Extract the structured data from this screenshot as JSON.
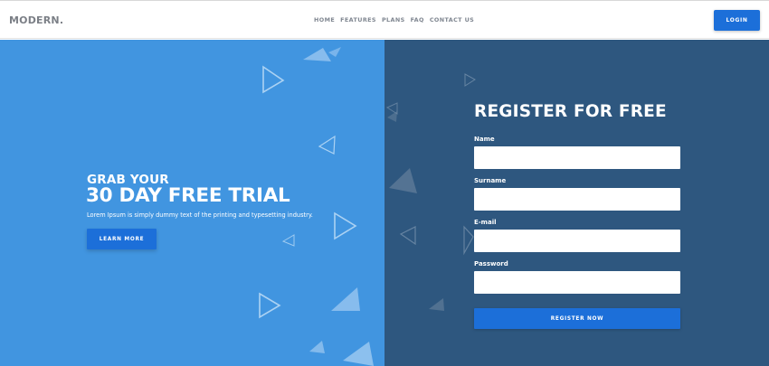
{
  "header": {
    "logo": "MODERN.",
    "nav": [
      "HOME",
      "FEATURES",
      "PLANS",
      "FAQ",
      "CONTACT US"
    ],
    "login_label": "LOGIN"
  },
  "hero": {
    "subtitle": "GRAB YOUR",
    "title": "30 DAY FREE TRIAL",
    "description": "Lorem Ipsum is simply dummy text of the printing and typesetting industry.",
    "button_label": "LEARN MORE"
  },
  "form": {
    "title": "REGISTER FOR FREE",
    "fields": [
      {
        "label": "Name",
        "value": ""
      },
      {
        "label": "Surname",
        "value": ""
      },
      {
        "label": "E-mail",
        "value": ""
      },
      {
        "label": "Password",
        "value": ""
      }
    ],
    "submit_label": "REGISTER NOW"
  },
  "colors": {
    "left_panel": "#4195e0",
    "right_panel": "#2e577f",
    "accent": "#1c6fd9"
  }
}
